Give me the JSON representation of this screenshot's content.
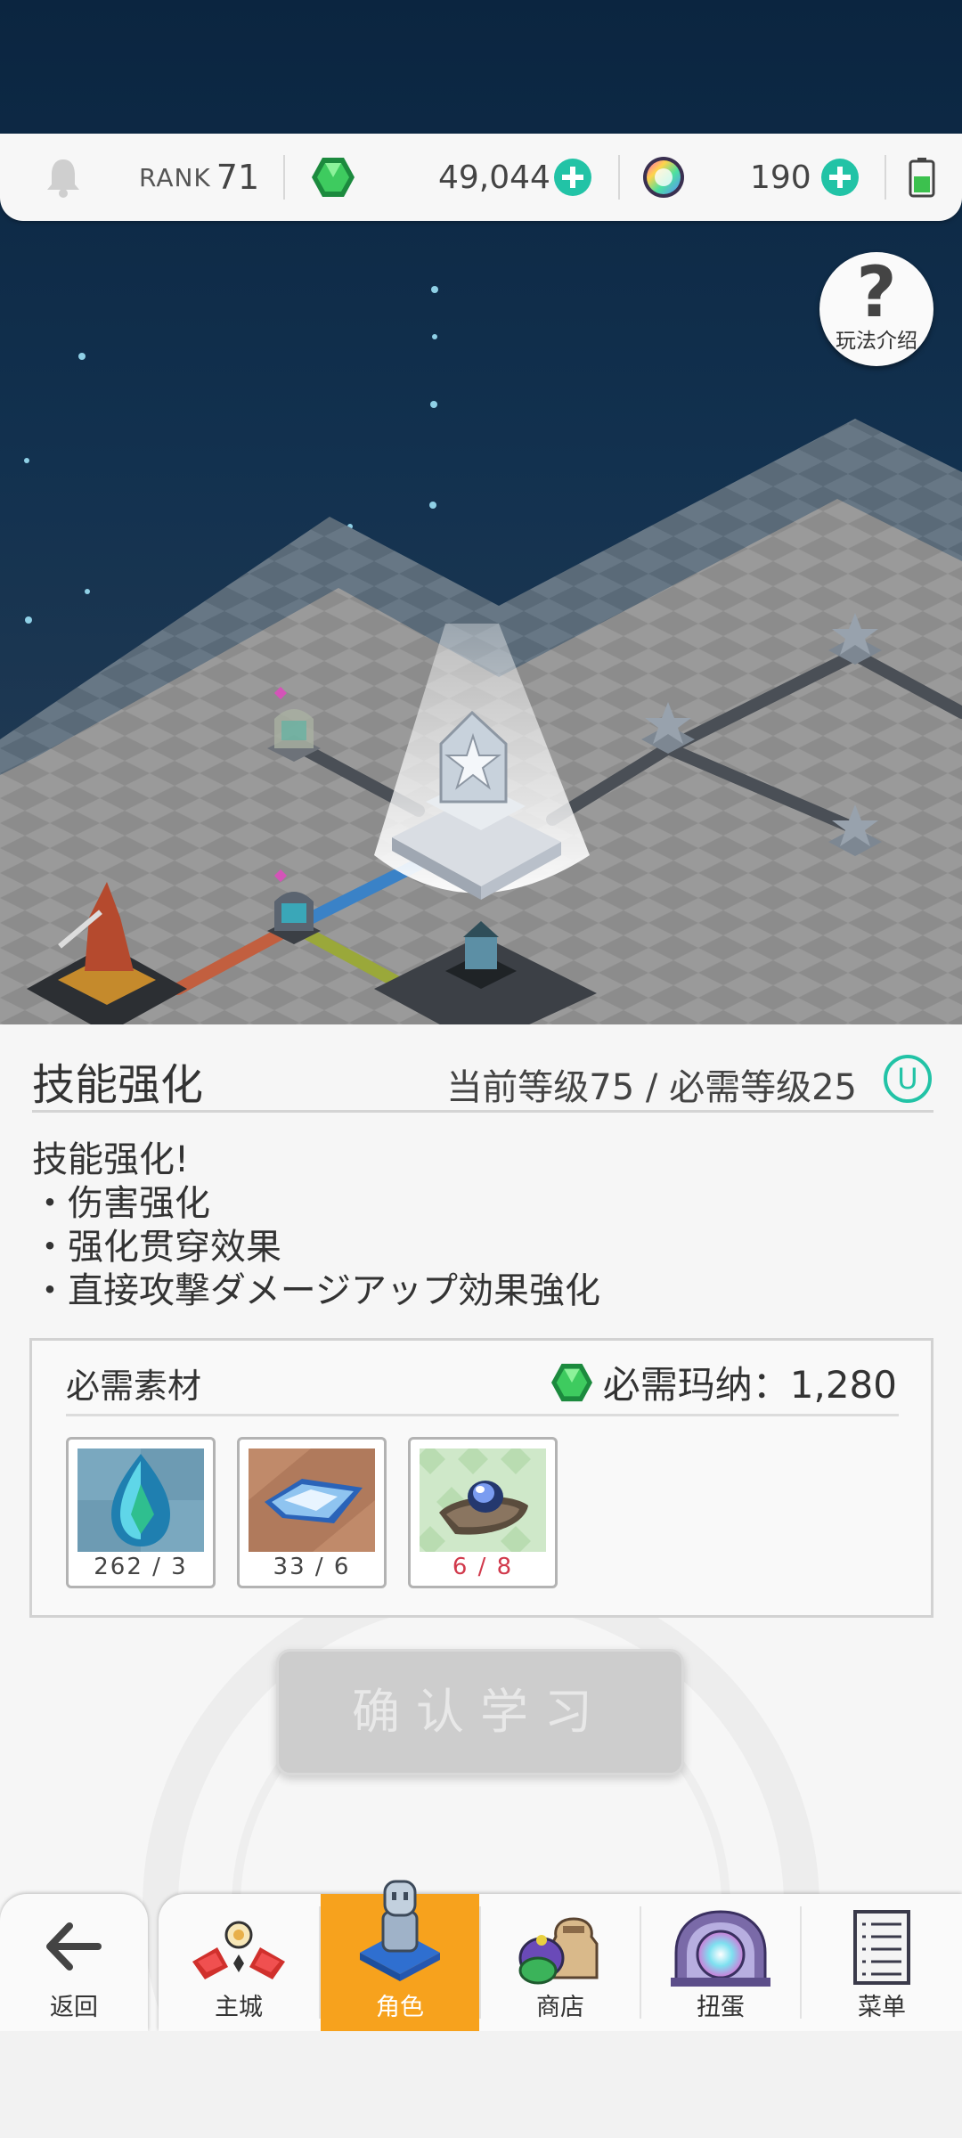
{
  "status_bar": {
    "rank_label": "RANK",
    "rank_value": "71",
    "gem_amount": "49,044",
    "orb_amount": "190",
    "icons": [
      "bell-icon",
      "green-gem-icon",
      "rainbow-orb-icon",
      "battery-icon"
    ]
  },
  "help": {
    "icon": "?",
    "label": "玩法介绍"
  },
  "skill": {
    "title": "技能强化",
    "level_info": "当前等级75 / 必需等级25",
    "badge": "U",
    "description": [
      "技能强化!",
      "・伤害强化",
      "・强化贯穿效果",
      "・直接攻撃ダメージアップ効果強化"
    ]
  },
  "materials": {
    "title": "必需素材",
    "cost_label": "必需玛纳：1,280",
    "items": [
      {
        "icon": "blue-crystal-icon",
        "count": "262 / 3",
        "insufficient": false
      },
      {
        "icon": "blue-shard-icon",
        "count": "33 / 6",
        "insufficient": false
      },
      {
        "icon": "orb-ring-icon",
        "count": "6 / 8",
        "insufficient": true
      }
    ]
  },
  "confirm_button": "确认学习",
  "nav": {
    "back_label": "返回",
    "tabs": [
      {
        "label": "主城",
        "icon": "castle-icon",
        "active": false
      },
      {
        "label": "角色",
        "icon": "character-icon",
        "active": true
      },
      {
        "label": "商店",
        "icon": "shop-bags-icon",
        "active": false
      },
      {
        "label": "扭蛋",
        "icon": "gacha-machine-icon",
        "active": false
      },
      {
        "label": "菜单",
        "icon": "menu-list-icon",
        "active": false
      }
    ]
  },
  "colors": {
    "accent": "#22c3a6",
    "active_tab": "#f7a21d",
    "insufficient": "#d13a4c",
    "sky": "#0b2540"
  }
}
